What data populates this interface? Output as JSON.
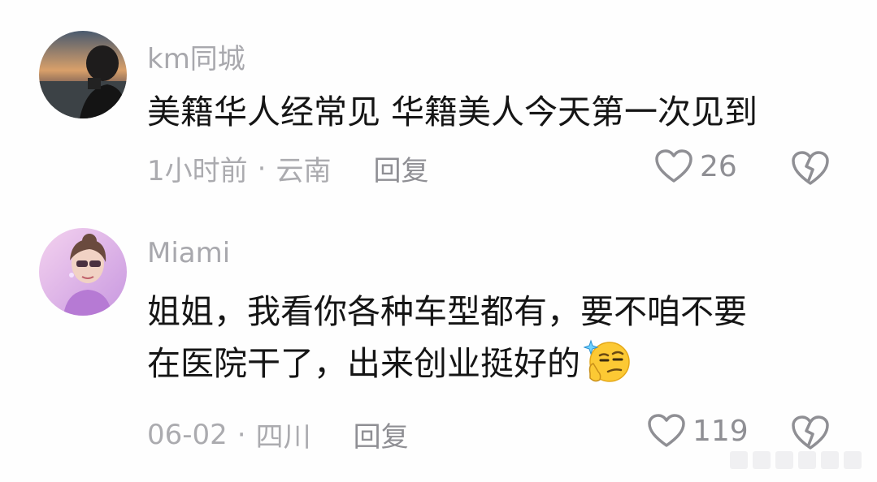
{
  "comments": [
    {
      "username": "km同城",
      "content_lines": [
        "美籍华人经常见 华籍美人今天第一次见到"
      ],
      "time": "1小时前",
      "location": "云南",
      "reply_label": "回复",
      "like_count": "26"
    },
    {
      "username": "Miami",
      "content_lines": [
        "姐姐，我看你各种车型都有，要不咱不要",
        "在医院干了，出来创业挺好的"
      ],
      "time": "06-02",
      "location": "四川",
      "reply_label": "回复",
      "like_count": "119"
    }
  ],
  "meta_separator": "·",
  "icons": {
    "like": "heart-outline-icon",
    "dislike": "broken-heart-icon",
    "emoji": "thinking-smirk-emoji"
  },
  "colors": {
    "username": "#a8a8ad",
    "content": "#151515",
    "meta": "#ababaf",
    "icon": "#8f8f94"
  }
}
